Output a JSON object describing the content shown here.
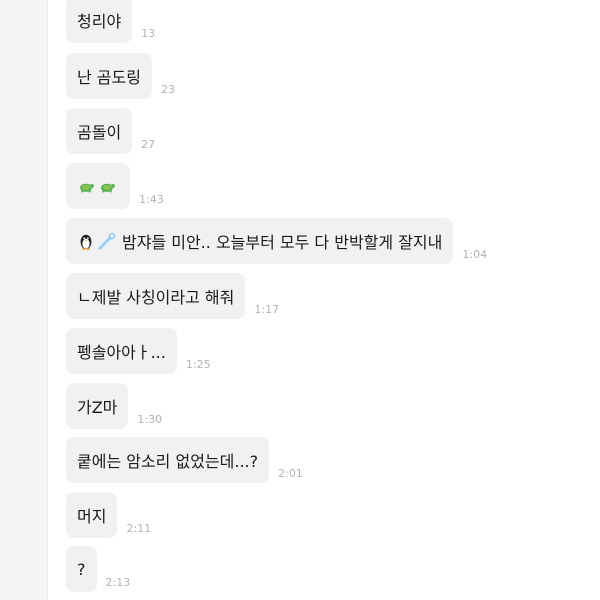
{
  "messages": [
    {
      "text": "청리야",
      "time": "13"
    },
    {
      "text": "난 곰도링",
      "time": "23"
    },
    {
      "text": "곰돌이",
      "time": "27"
    },
    {
      "text": "",
      "time": "1:43",
      "icons": [
        "turtle-emoji",
        "turtle-emoji"
      ]
    },
    {
      "text": "밤쟈들 미안.. 오늘부터 모두 다 반박할게 잘지내",
      "time": "1:04",
      "icons": [
        "penguin-emoji",
        "comet-emoji"
      ]
    },
    {
      "text": "ㄴ제발 사칭이라고 해줘",
      "time": "1:17"
    },
    {
      "text": "펭솔아아ㅏ...",
      "time": "1:25"
    },
    {
      "text": "가Z마",
      "time": "1:30"
    },
    {
      "text": "쿹에는 암소리 없었는데...?",
      "time": "2:01"
    },
    {
      "text": "머지",
      "time": "2:11"
    },
    {
      "text": "?",
      "time": "2:13"
    }
  ],
  "colors": {
    "bubble_bg": "#f1f1f1",
    "time_text": "#b3b3b3",
    "gutter_bg": "#f5f5f5"
  }
}
